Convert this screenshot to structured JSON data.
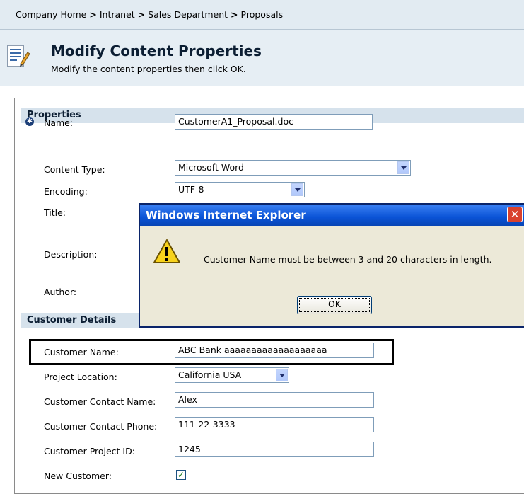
{
  "breadcrumb": {
    "items": [
      "Company Home",
      "Intranet",
      "Sales Department",
      "Proposals"
    ],
    "separator": ">"
  },
  "header": {
    "title": "Modify Content Properties",
    "subtitle": "Modify the content properties then click OK.",
    "icon": "document-edit-icon"
  },
  "properties": {
    "section_title": "Properties",
    "name_label": "Name:",
    "name_value": "CustomerA1_Proposal.doc",
    "content_type_label": "Content Type:",
    "content_type_value": "Microsoft Word",
    "encoding_label": "Encoding:",
    "encoding_value": "UTF-8",
    "title_label": "Title:",
    "description_label": "Description:",
    "author_label": "Author:"
  },
  "customer": {
    "section_title": "Customer Details",
    "name_label": "Customer Name:",
    "name_value": "ABC Bank aaaaaaaaaaaaaaaaaaa",
    "location_label": "Project Location:",
    "location_value": "California USA",
    "contact_name_label": "Customer Contact Name:",
    "contact_name_value": "Alex",
    "contact_phone_label": "Customer Contact Phone:",
    "contact_phone_value": "111-22-3333",
    "project_id_label": "Customer Project ID:",
    "project_id_value": "1245",
    "new_customer_label": "New Customer:",
    "new_customer_checked": true
  },
  "dialog": {
    "title": "Windows Internet Explorer",
    "message": "Customer Name must be between 3 and 20 characters in length.",
    "ok_label": "OK",
    "close_glyph": "✕",
    "icon": "warning-icon"
  },
  "colors": {
    "titlebar": "#0a53d6",
    "dialog_bg": "#ece9d8",
    "section_bar": "#d6e2ec"
  }
}
